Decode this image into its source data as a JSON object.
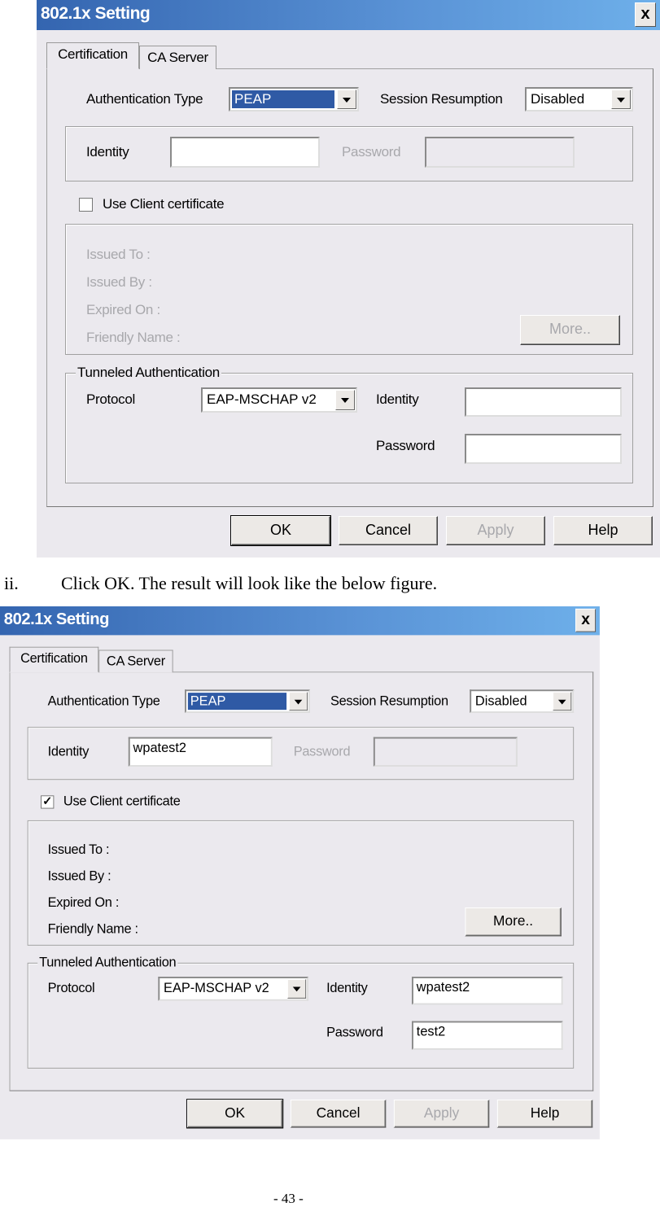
{
  "dialogs": [
    {
      "title": "802.1x Setting",
      "close_label": "x",
      "tabs": [
        "Certification",
        "CA Server"
      ],
      "auth_type_label": "Authentication Type",
      "auth_type_value": "PEAP",
      "session_resumption_label": "Session Resumption",
      "session_resumption_value": "Disabled",
      "identity_label": "Identity",
      "identity_value": "",
      "password_label": "Password",
      "password_value": "",
      "use_client_cert_label": "Use Client certificate",
      "use_client_cert_checked": false,
      "cert_enabled": false,
      "cert_fields": [
        "Issued To :",
        "Issued By :",
        "Expired On :",
        "Friendly Name :"
      ],
      "more_label": "More..",
      "tunneled_legend": "Tunneled Authentication",
      "protocol_label": "Protocol",
      "protocol_value": "EAP-MSCHAP v2",
      "tunnel_identity_label": "Identity",
      "tunnel_identity_value": "",
      "tunnel_password_label": "Password",
      "tunnel_password_value": "",
      "buttons": [
        "OK",
        "Cancel",
        "Apply",
        "Help"
      ]
    },
    {
      "title": "802.1x Setting",
      "close_label": "x",
      "tabs": [
        "Certification",
        "CA Server"
      ],
      "auth_type_label": "Authentication Type",
      "auth_type_value": "PEAP",
      "session_resumption_label": "Session Resumption",
      "session_resumption_value": "Disabled",
      "identity_label": "Identity",
      "identity_value": "wpatest2",
      "password_label": "Password",
      "password_value": "",
      "use_client_cert_label": "Use Client certificate",
      "use_client_cert_checked": true,
      "cert_enabled": true,
      "cert_fields": [
        "Issued To :",
        "Issued By :",
        "Expired On :",
        "Friendly Name :"
      ],
      "more_label": "More..",
      "tunneled_legend": "Tunneled Authentication",
      "protocol_label": "Protocol",
      "protocol_value": "EAP-MSCHAP v2",
      "tunnel_identity_label": "Identity",
      "tunnel_identity_value": "wpatest2",
      "tunnel_password_label": "Password",
      "tunnel_password_value": "test2",
      "buttons": [
        "OK",
        "Cancel",
        "Apply",
        "Help"
      ]
    }
  ],
  "step": {
    "number": "ii.",
    "text": "Click OK. The result will look like the below figure."
  },
  "footer": {
    "page": "- 43 -"
  },
  "colors": {
    "titlebar_start": "#3465b0",
    "titlebar_end": "#6eb0ea",
    "selection": "#2f5aa5",
    "disabled_text": "#a8a8ac"
  }
}
